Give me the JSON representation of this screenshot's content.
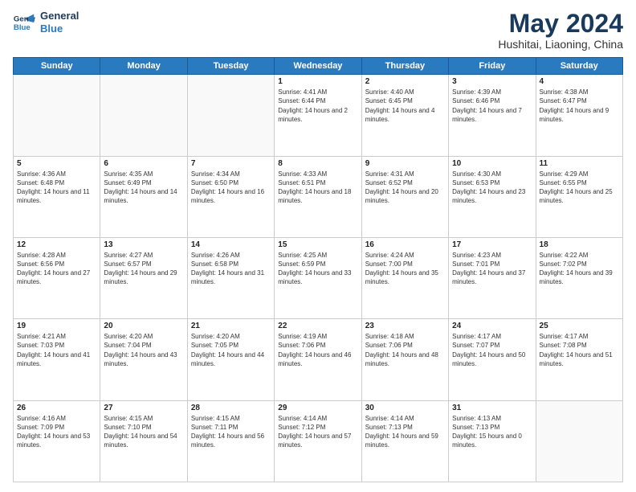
{
  "header": {
    "logo_line1": "General",
    "logo_line2": "Blue",
    "month_title": "May 2024",
    "location": "Hushitai, Liaoning, China"
  },
  "weekdays": [
    "Sunday",
    "Monday",
    "Tuesday",
    "Wednesday",
    "Thursday",
    "Friday",
    "Saturday"
  ],
  "weeks": [
    [
      {
        "day": "",
        "sunrise": "",
        "sunset": "",
        "daylight": ""
      },
      {
        "day": "",
        "sunrise": "",
        "sunset": "",
        "daylight": ""
      },
      {
        "day": "",
        "sunrise": "",
        "sunset": "",
        "daylight": ""
      },
      {
        "day": "1",
        "sunrise": "Sunrise: 4:41 AM",
        "sunset": "Sunset: 6:44 PM",
        "daylight": "Daylight: 14 hours and 2 minutes."
      },
      {
        "day": "2",
        "sunrise": "Sunrise: 4:40 AM",
        "sunset": "Sunset: 6:45 PM",
        "daylight": "Daylight: 14 hours and 4 minutes."
      },
      {
        "day": "3",
        "sunrise": "Sunrise: 4:39 AM",
        "sunset": "Sunset: 6:46 PM",
        "daylight": "Daylight: 14 hours and 7 minutes."
      },
      {
        "day": "4",
        "sunrise": "Sunrise: 4:38 AM",
        "sunset": "Sunset: 6:47 PM",
        "daylight": "Daylight: 14 hours and 9 minutes."
      }
    ],
    [
      {
        "day": "5",
        "sunrise": "Sunrise: 4:36 AM",
        "sunset": "Sunset: 6:48 PM",
        "daylight": "Daylight: 14 hours and 11 minutes."
      },
      {
        "day": "6",
        "sunrise": "Sunrise: 4:35 AM",
        "sunset": "Sunset: 6:49 PM",
        "daylight": "Daylight: 14 hours and 14 minutes."
      },
      {
        "day": "7",
        "sunrise": "Sunrise: 4:34 AM",
        "sunset": "Sunset: 6:50 PM",
        "daylight": "Daylight: 14 hours and 16 minutes."
      },
      {
        "day": "8",
        "sunrise": "Sunrise: 4:33 AM",
        "sunset": "Sunset: 6:51 PM",
        "daylight": "Daylight: 14 hours and 18 minutes."
      },
      {
        "day": "9",
        "sunrise": "Sunrise: 4:31 AM",
        "sunset": "Sunset: 6:52 PM",
        "daylight": "Daylight: 14 hours and 20 minutes."
      },
      {
        "day": "10",
        "sunrise": "Sunrise: 4:30 AM",
        "sunset": "Sunset: 6:53 PM",
        "daylight": "Daylight: 14 hours and 23 minutes."
      },
      {
        "day": "11",
        "sunrise": "Sunrise: 4:29 AM",
        "sunset": "Sunset: 6:55 PM",
        "daylight": "Daylight: 14 hours and 25 minutes."
      }
    ],
    [
      {
        "day": "12",
        "sunrise": "Sunrise: 4:28 AM",
        "sunset": "Sunset: 6:56 PM",
        "daylight": "Daylight: 14 hours and 27 minutes."
      },
      {
        "day": "13",
        "sunrise": "Sunrise: 4:27 AM",
        "sunset": "Sunset: 6:57 PM",
        "daylight": "Daylight: 14 hours and 29 minutes."
      },
      {
        "day": "14",
        "sunrise": "Sunrise: 4:26 AM",
        "sunset": "Sunset: 6:58 PM",
        "daylight": "Daylight: 14 hours and 31 minutes."
      },
      {
        "day": "15",
        "sunrise": "Sunrise: 4:25 AM",
        "sunset": "Sunset: 6:59 PM",
        "daylight": "Daylight: 14 hours and 33 minutes."
      },
      {
        "day": "16",
        "sunrise": "Sunrise: 4:24 AM",
        "sunset": "Sunset: 7:00 PM",
        "daylight": "Daylight: 14 hours and 35 minutes."
      },
      {
        "day": "17",
        "sunrise": "Sunrise: 4:23 AM",
        "sunset": "Sunset: 7:01 PM",
        "daylight": "Daylight: 14 hours and 37 minutes."
      },
      {
        "day": "18",
        "sunrise": "Sunrise: 4:22 AM",
        "sunset": "Sunset: 7:02 PM",
        "daylight": "Daylight: 14 hours and 39 minutes."
      }
    ],
    [
      {
        "day": "19",
        "sunrise": "Sunrise: 4:21 AM",
        "sunset": "Sunset: 7:03 PM",
        "daylight": "Daylight: 14 hours and 41 minutes."
      },
      {
        "day": "20",
        "sunrise": "Sunrise: 4:20 AM",
        "sunset": "Sunset: 7:04 PM",
        "daylight": "Daylight: 14 hours and 43 minutes."
      },
      {
        "day": "21",
        "sunrise": "Sunrise: 4:20 AM",
        "sunset": "Sunset: 7:05 PM",
        "daylight": "Daylight: 14 hours and 44 minutes."
      },
      {
        "day": "22",
        "sunrise": "Sunrise: 4:19 AM",
        "sunset": "Sunset: 7:06 PM",
        "daylight": "Daylight: 14 hours and 46 minutes."
      },
      {
        "day": "23",
        "sunrise": "Sunrise: 4:18 AM",
        "sunset": "Sunset: 7:06 PM",
        "daylight": "Daylight: 14 hours and 48 minutes."
      },
      {
        "day": "24",
        "sunrise": "Sunrise: 4:17 AM",
        "sunset": "Sunset: 7:07 PM",
        "daylight": "Daylight: 14 hours and 50 minutes."
      },
      {
        "day": "25",
        "sunrise": "Sunrise: 4:17 AM",
        "sunset": "Sunset: 7:08 PM",
        "daylight": "Daylight: 14 hours and 51 minutes."
      }
    ],
    [
      {
        "day": "26",
        "sunrise": "Sunrise: 4:16 AM",
        "sunset": "Sunset: 7:09 PM",
        "daylight": "Daylight: 14 hours and 53 minutes."
      },
      {
        "day": "27",
        "sunrise": "Sunrise: 4:15 AM",
        "sunset": "Sunset: 7:10 PM",
        "daylight": "Daylight: 14 hours and 54 minutes."
      },
      {
        "day": "28",
        "sunrise": "Sunrise: 4:15 AM",
        "sunset": "Sunset: 7:11 PM",
        "daylight": "Daylight: 14 hours and 56 minutes."
      },
      {
        "day": "29",
        "sunrise": "Sunrise: 4:14 AM",
        "sunset": "Sunset: 7:12 PM",
        "daylight": "Daylight: 14 hours and 57 minutes."
      },
      {
        "day": "30",
        "sunrise": "Sunrise: 4:14 AM",
        "sunset": "Sunset: 7:13 PM",
        "daylight": "Daylight: 14 hours and 59 minutes."
      },
      {
        "day": "31",
        "sunrise": "Sunrise: 4:13 AM",
        "sunset": "Sunset: 7:13 PM",
        "daylight": "Daylight: 15 hours and 0 minutes."
      },
      {
        "day": "",
        "sunrise": "",
        "sunset": "",
        "daylight": ""
      }
    ]
  ]
}
